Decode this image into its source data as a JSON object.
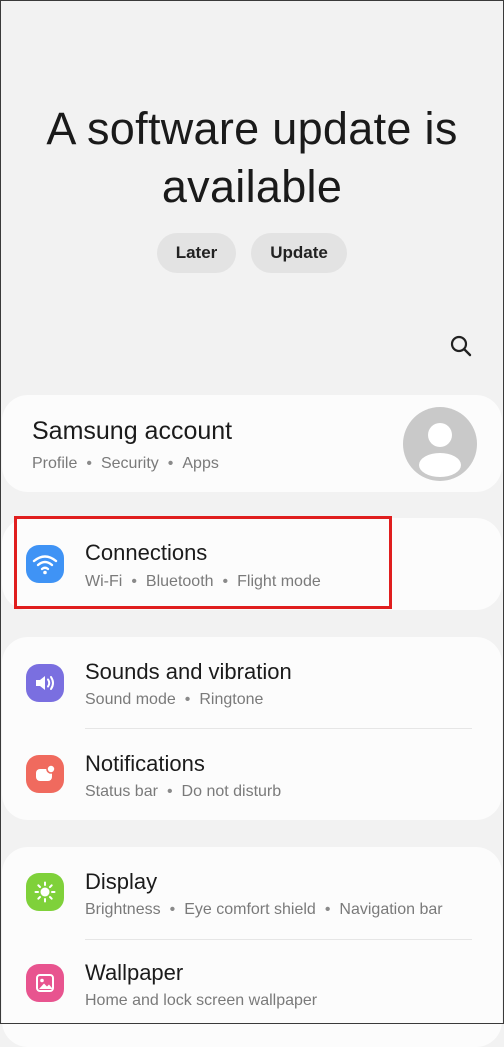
{
  "update_prompt": {
    "title_line1": "A software update is",
    "title_line2": "available",
    "later_label": "Later",
    "update_label": "Update"
  },
  "search": {
    "icon": "search-icon"
  },
  "account": {
    "title": "Samsung account",
    "subtitle_items": [
      "Profile",
      "Security",
      "Apps"
    ],
    "avatar_icon": "person-silhouette-icon"
  },
  "connections": {
    "title": "Connections",
    "subtitle_items": [
      "Wi-Fi",
      "Bluetooth",
      "Flight mode"
    ],
    "icon": "wifi-icon",
    "icon_color": "#3f93f5",
    "highlight_color": "#e01e1e"
  },
  "sounds": {
    "title": "Sounds and vibration",
    "subtitle_items": [
      "Sound mode",
      "Ringtone"
    ],
    "icon": "speaker-icon",
    "icon_color": "#7a6fe0"
  },
  "notifications": {
    "title": "Notifications",
    "subtitle_items": [
      "Status bar",
      "Do not disturb"
    ],
    "icon": "notification-badge-icon",
    "icon_color": "#f06a5e"
  },
  "display": {
    "title": "Display",
    "subtitle_items": [
      "Brightness",
      "Eye comfort shield",
      "Navigation bar"
    ],
    "icon": "sun-icon",
    "icon_color": "#7fd13a"
  },
  "wallpaper": {
    "title": "Wallpaper",
    "subtitle_items": [
      "Home and lock screen wallpaper"
    ],
    "icon": "image-icon",
    "icon_color": "#e8548f"
  },
  "separator": "•"
}
